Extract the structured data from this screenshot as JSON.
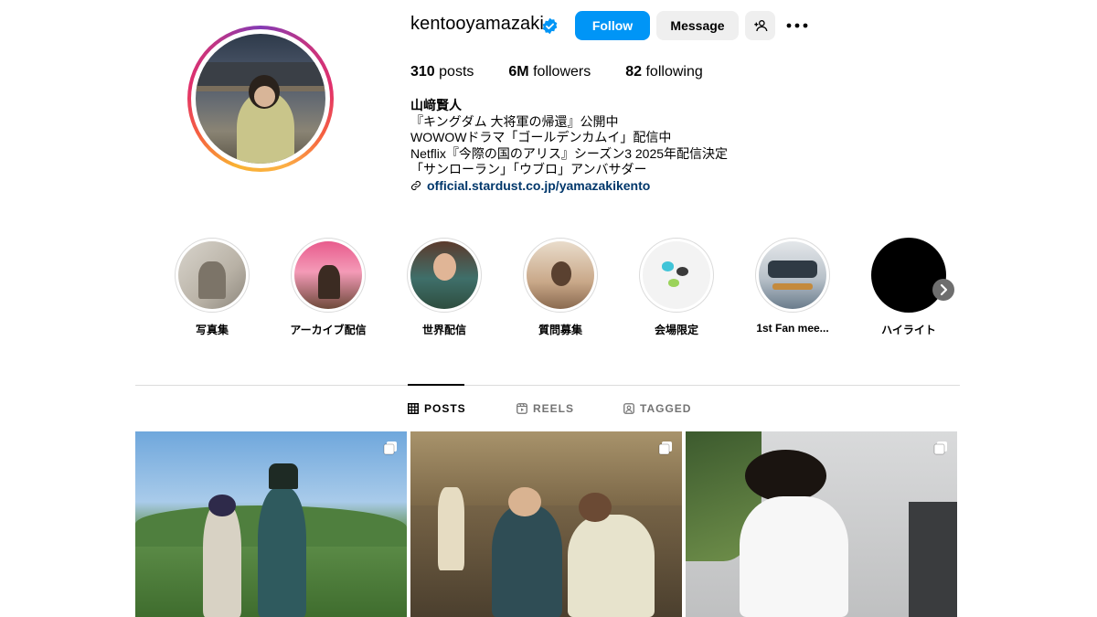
{
  "profile": {
    "username": "kentooyamazaki",
    "follow_label": "Follow",
    "message_label": "Message",
    "stats": {
      "posts": "310",
      "posts_label": "posts",
      "followers": "6M",
      "followers_label": "followers",
      "following": "82",
      "following_label": "following"
    },
    "bio": {
      "name": "山﨑賢人",
      "lines": [
        "『キングダム 大将軍の帰還』公開中",
        "WOWOWドラマ「ゴールデンカムイ」配信中",
        "Netflix『今際の国のアリス』シーズン3 2025年配信決定",
        "「サンローラン」「ウブロ」アンバサダー"
      ],
      "link": "official.stardust.co.jp/yamazakikento"
    },
    "colors": {
      "accent": "#0095f6",
      "link": "#00376b",
      "verified": "#0095f6"
    }
  },
  "highlights": [
    {
      "label": "写真集",
      "icon": "photobook-thumb"
    },
    {
      "label": "アーカイブ配信",
      "icon": "archive-thumb"
    },
    {
      "label": "世界配信",
      "icon": "world-thumb"
    },
    {
      "label": "質問募集",
      "icon": "question-thumb"
    },
    {
      "label": "会場限定",
      "icon": "venue-thumb"
    },
    {
      "label": "1st Fan mee...",
      "icon": "fanmeeting-thumb"
    },
    {
      "label": "ハイライト",
      "icon": "highlight-thumb"
    }
  ],
  "tabs": [
    {
      "label": "POSTS",
      "icon": "grid-icon",
      "active": true
    },
    {
      "label": "REELS",
      "icon": "reels-icon",
      "active": false
    },
    {
      "label": "TAGGED",
      "icon": "tagged-icon",
      "active": false
    }
  ],
  "posts": [
    {
      "icon": "multi-post-icon"
    },
    {
      "icon": "multi-post-icon"
    },
    {
      "icon": "multi-post-icon"
    }
  ]
}
